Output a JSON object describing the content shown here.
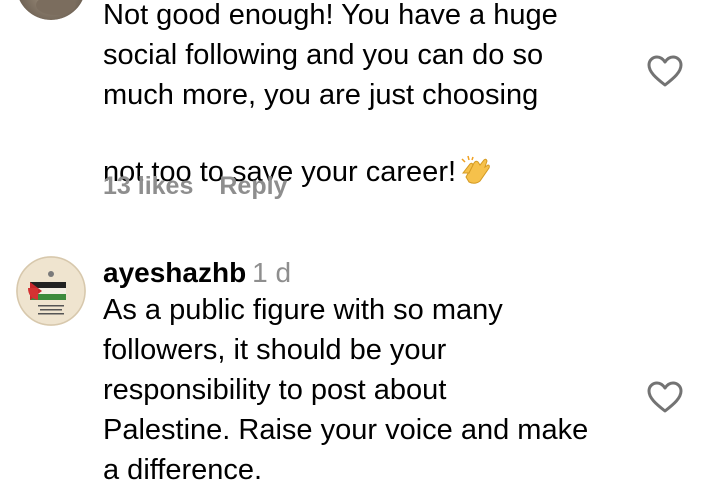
{
  "comments": [
    {
      "username": "",
      "timestamp": "",
      "text": "Not good enough! You have a huge\nsocial following and you can do so\nmuch more, you are just choosing\nnot too to save your career!",
      "emoji": "clapping-hands-emoji",
      "likes": "13 likes",
      "reply": "Reply"
    },
    {
      "username": "ayeshazhb",
      "timestamp": "1 d",
      "text": "As a public figure with so many\nfollowers, it should be your\nresponsibility to post about\nPalestine. Raise your voice and make\na difference.",
      "avatar_icon": "palestine-flag-avatar"
    }
  ],
  "icons": {
    "like": "heart-outline-icon"
  },
  "colors": {
    "text": "#000000",
    "muted": "#8e8e8e",
    "background": "#ffffff"
  }
}
